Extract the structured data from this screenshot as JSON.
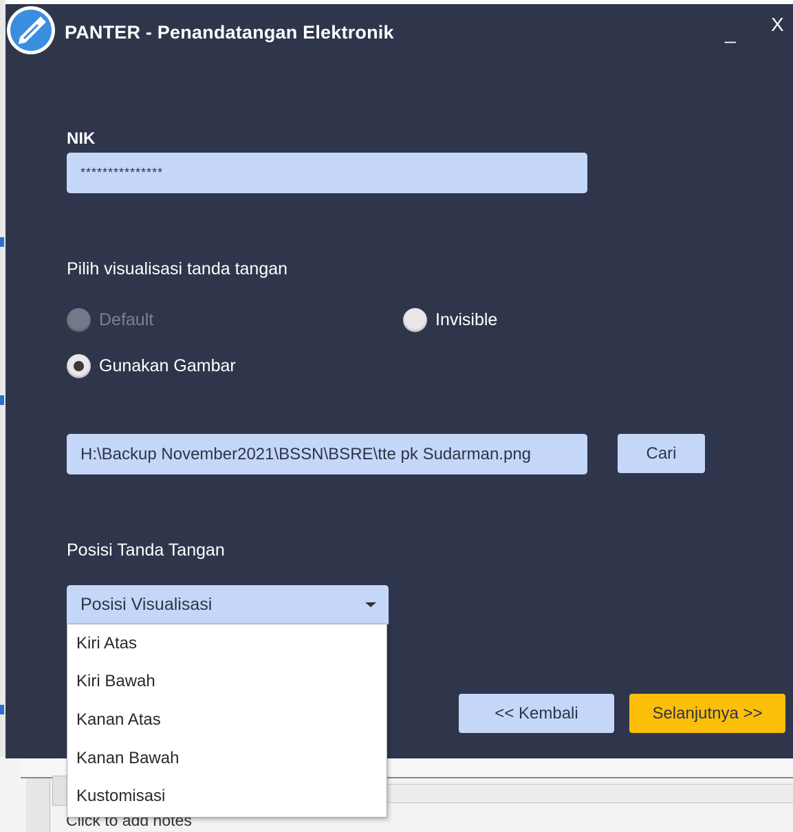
{
  "window": {
    "title": "PANTER - Penandatangan Elektronik",
    "minimize_label": "_",
    "close_label": "X"
  },
  "form": {
    "nik_label": "NIK",
    "nik_value": "***************",
    "visual_label": "Pilih visualisasi tanda tangan",
    "radios": [
      {
        "label": "Default",
        "checked": false,
        "disabled": true
      },
      {
        "label": "Invisible",
        "checked": false,
        "disabled": false
      },
      {
        "label": "Gunakan Gambar",
        "checked": true,
        "disabled": false
      }
    ],
    "image_path": "H:\\Backup November2021\\BSSN\\BSRE\\tte pk Sudarman.png",
    "browse_label": "Cari",
    "position_label": "Posisi Tanda Tangan",
    "position_select": "Posisi Visualisasi",
    "position_options": [
      "Kiri Atas",
      "Kiri Bawah",
      "Kanan Atas",
      "Kanan Bawah",
      "Kustomisasi"
    ]
  },
  "footer": {
    "back_label": "<< Kembali",
    "next_label": "Selanjutnya >>"
  },
  "background": {
    "notes_placeholder": "Click to add notes"
  },
  "colors": {
    "dialog_bg": "#2f364c",
    "field_bg": "#c5d7f8",
    "accent": "#fbbf0a"
  }
}
